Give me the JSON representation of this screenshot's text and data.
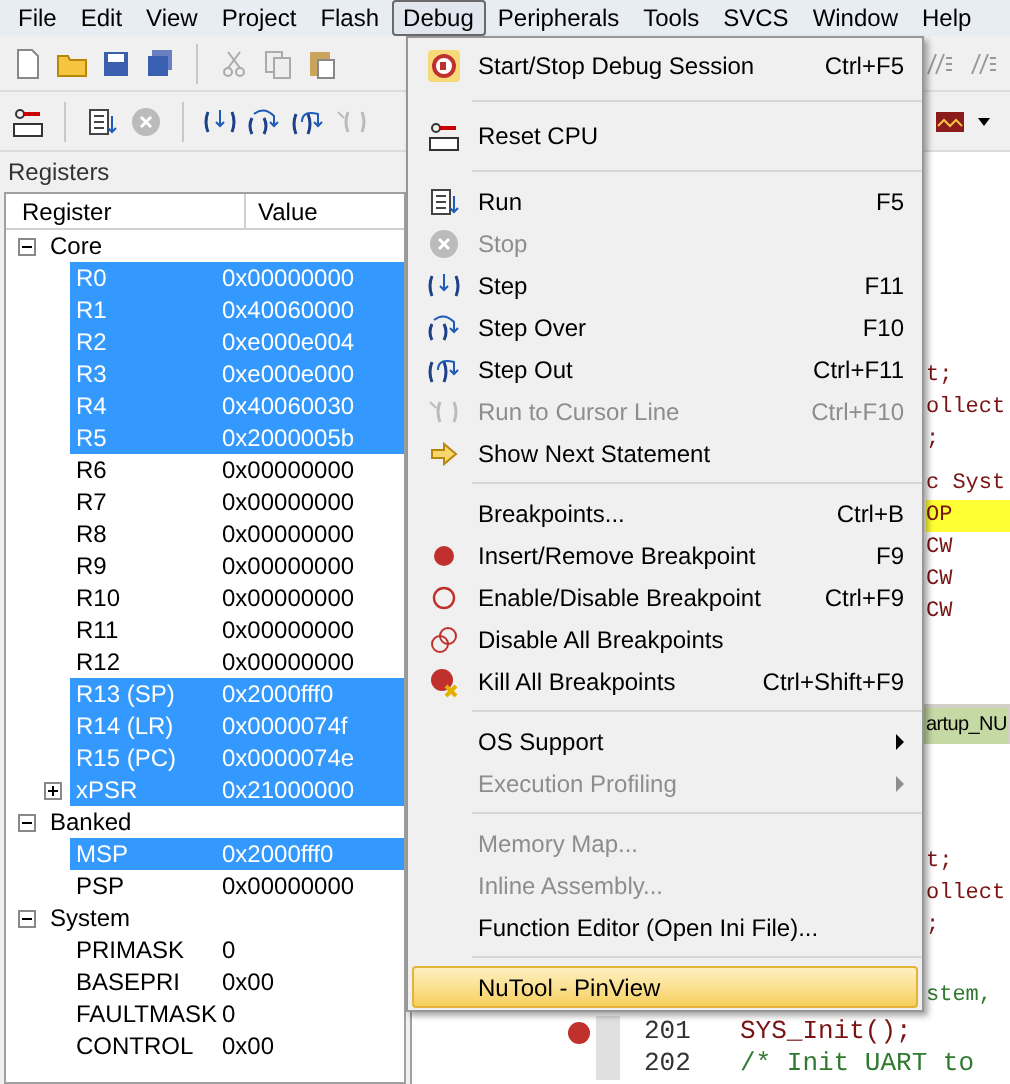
{
  "menubar": [
    {
      "label": "File",
      "selected": false
    },
    {
      "label": "Edit",
      "selected": false
    },
    {
      "label": "View",
      "selected": false
    },
    {
      "label": "Project",
      "selected": false
    },
    {
      "label": "Flash",
      "selected": false
    },
    {
      "label": "Debug",
      "selected": true
    },
    {
      "label": "Peripherals",
      "selected": false
    },
    {
      "label": "Tools",
      "selected": false
    },
    {
      "label": "SVCS",
      "selected": false
    },
    {
      "label": "Window",
      "selected": false
    },
    {
      "label": "Help",
      "selected": false
    }
  ],
  "registers": {
    "title": "Registers",
    "columns": [
      "Register",
      "Value"
    ],
    "groups": [
      {
        "name": "Core",
        "expanded": true,
        "children": [
          {
            "name": "R0",
            "value": "0x00000000",
            "selected": true
          },
          {
            "name": "R1",
            "value": "0x40060000",
            "selected": true
          },
          {
            "name": "R2",
            "value": "0xe000e004",
            "selected": true
          },
          {
            "name": "R3",
            "value": "0xe000e000",
            "selected": true
          },
          {
            "name": "R4",
            "value": "0x40060030",
            "selected": true
          },
          {
            "name": "R5",
            "value": "0x2000005b",
            "selected": true
          },
          {
            "name": "R6",
            "value": "0x00000000",
            "selected": false
          },
          {
            "name": "R7",
            "value": "0x00000000",
            "selected": false
          },
          {
            "name": "R8",
            "value": "0x00000000",
            "selected": false
          },
          {
            "name": "R9",
            "value": "0x00000000",
            "selected": false
          },
          {
            "name": "R10",
            "value": "0x00000000",
            "selected": false
          },
          {
            "name": "R11",
            "value": "0x00000000",
            "selected": false
          },
          {
            "name": "R12",
            "value": "0x00000000",
            "selected": false
          },
          {
            "name": "R13 (SP)",
            "value": "0x2000fff0",
            "selected": true
          },
          {
            "name": "R14 (LR)",
            "value": "0x0000074f",
            "selected": true
          },
          {
            "name": "R15 (PC)",
            "value": "0x0000074e",
            "selected": true
          },
          {
            "name": "xPSR",
            "value": "0x21000000",
            "selected": true,
            "expanded": false
          }
        ]
      },
      {
        "name": "Banked",
        "expanded": true,
        "children": [
          {
            "name": "MSP",
            "value": "0x2000fff0",
            "selected": true
          },
          {
            "name": "PSP",
            "value": "0x00000000",
            "selected": false
          }
        ]
      },
      {
        "name": "System",
        "expanded": true,
        "children": [
          {
            "name": "PRIMASK",
            "value": "0",
            "selected": false
          },
          {
            "name": "BASEPRI",
            "value": "0x00",
            "selected": false
          },
          {
            "name": "FAULTMASK",
            "value": "0",
            "selected": false
          },
          {
            "name": "CONTROL",
            "value": "0x00",
            "selected": false
          }
        ]
      }
    ]
  },
  "debug_menu": [
    {
      "kind": "item",
      "label": "Start/Stop Debug Session",
      "shortcut": "Ctrl+F5",
      "disabled": false,
      "selected": false
    },
    {
      "kind": "separator"
    },
    {
      "kind": "item",
      "label": "Reset CPU",
      "disabled": false,
      "selected": false
    },
    {
      "kind": "separator"
    },
    {
      "kind": "item",
      "label": "Run",
      "shortcut": "F5",
      "disabled": false,
      "selected": false
    },
    {
      "kind": "item",
      "label": "Stop",
      "disabled": true,
      "selected": false
    },
    {
      "kind": "item",
      "label": "Step",
      "shortcut": "F11",
      "disabled": false,
      "selected": false
    },
    {
      "kind": "item",
      "label": "Step Over",
      "shortcut": "F10",
      "disabled": false,
      "selected": false
    },
    {
      "kind": "item",
      "label": "Step Out",
      "shortcut": "Ctrl+F11",
      "disabled": false,
      "selected": false
    },
    {
      "kind": "item",
      "label": "Run to Cursor Line",
      "shortcut": "Ctrl+F10",
      "disabled": true,
      "selected": false
    },
    {
      "kind": "item",
      "label": "Show Next Statement",
      "disabled": false,
      "selected": false
    },
    {
      "kind": "separator"
    },
    {
      "kind": "item",
      "label": "Breakpoints...",
      "shortcut": "Ctrl+B",
      "disabled": false,
      "selected": false
    },
    {
      "kind": "item",
      "label": "Insert/Remove Breakpoint",
      "shortcut": "F9",
      "disabled": false,
      "selected": false
    },
    {
      "kind": "item",
      "label": "Enable/Disable Breakpoint",
      "shortcut": "Ctrl+F9",
      "disabled": false,
      "selected": false
    },
    {
      "kind": "item",
      "label": "Disable All Breakpoints",
      "disabled": false,
      "selected": false
    },
    {
      "kind": "item",
      "label": "Kill All Breakpoints",
      "shortcut": "Ctrl+Shift+F9",
      "disabled": false,
      "selected": false
    },
    {
      "kind": "separator"
    },
    {
      "kind": "submenu",
      "label": "OS Support",
      "disabled": false,
      "selected": false
    },
    {
      "kind": "submenu",
      "label": "Execution Profiling",
      "disabled": true,
      "selected": false
    },
    {
      "kind": "separator"
    },
    {
      "kind": "item",
      "label": "Memory Map...",
      "disabled": true,
      "selected": false
    },
    {
      "kind": "item",
      "label": "Inline Assembly...",
      "disabled": true,
      "selected": false
    },
    {
      "kind": "item",
      "label": "Function Editor (Open Ini File)...",
      "disabled": false,
      "selected": false
    },
    {
      "kind": "separator"
    },
    {
      "kind": "item",
      "label": "NuTool - PinView",
      "disabled": false,
      "selected": true
    }
  ],
  "editor": {
    "upper_blocks": [
      [
        {
          "text": "t;",
          "kind": "code",
          "current": false
        },
        {
          "text": "ollect",
          "kind": "code",
          "current": false
        },
        {
          "text": ";",
          "kind": "code",
          "current": false
        }
      ],
      [
        {
          "text": "c Syst",
          "kind": "code",
          "current": false
        },
        {
          "text": "OP",
          "kind": "code",
          "current": true
        },
        {
          "text": "CW",
          "kind": "code",
          "current": false
        },
        {
          "text": "CW",
          "kind": "code",
          "current": false
        },
        {
          "text": "CW",
          "kind": "code",
          "current": false
        }
      ]
    ],
    "tab": "artup_NU",
    "lower_blocks": [
      [
        {
          "text": "t;",
          "kind": "code"
        },
        {
          "text": "ollect",
          "kind": "code"
        },
        {
          "text": ";",
          "kind": "code"
        }
      ],
      [
        {
          "text": "stem,",
          "kind": "comment"
        }
      ]
    ],
    "numbered_lines": [
      {
        "number": "201",
        "text": "SYS_Init();",
        "kind": "code",
        "breakpoint": true
      },
      {
        "number": "202",
        "text": "/* Init UART to",
        "kind": "comment",
        "breakpoint": false
      }
    ]
  }
}
